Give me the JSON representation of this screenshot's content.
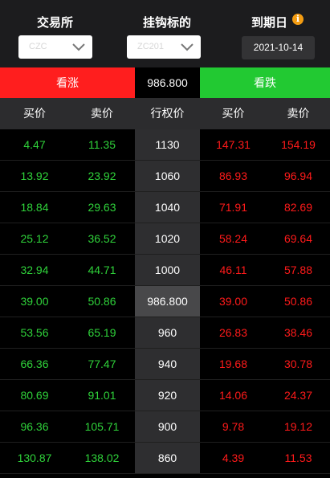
{
  "top": {
    "exchange_label": "交易所",
    "underlying_label": "挂钩标的",
    "expiry_label": "到期日",
    "info_icon": "info-icon",
    "exchange_value": "CZC",
    "underlying_value": "ZC201",
    "expiry_value": "2021-10-14"
  },
  "actions": {
    "up_label": "看涨",
    "underlying_price": "986.800",
    "down_label": "看跌"
  },
  "colors": {
    "up": "#ff1e1e",
    "down": "#22c932",
    "green_text": "#2fd23a",
    "red_text": "#ff1a1a"
  },
  "table": {
    "headers": [
      "买价",
      "卖价",
      "行权价",
      "买价",
      "卖价"
    ],
    "rows": [
      {
        "call_bid": "4.47",
        "call_ask": "11.35",
        "strike": "1130",
        "put_bid": "147.31",
        "put_ask": "154.19"
      },
      {
        "call_bid": "13.92",
        "call_ask": "23.92",
        "strike": "1060",
        "put_bid": "86.93",
        "put_ask": "96.94"
      },
      {
        "call_bid": "18.84",
        "call_ask": "29.63",
        "strike": "1040",
        "put_bid": "71.91",
        "put_ask": "82.69"
      },
      {
        "call_bid": "25.12",
        "call_ask": "36.52",
        "strike": "1020",
        "put_bid": "58.24",
        "put_ask": "69.64"
      },
      {
        "call_bid": "32.94",
        "call_ask": "44.71",
        "strike": "1000",
        "put_bid": "46.11",
        "put_ask": "57.88"
      },
      {
        "call_bid": "39.00",
        "call_ask": "50.86",
        "strike": "986.800",
        "put_bid": "39.00",
        "put_ask": "50.86",
        "atm": true
      },
      {
        "call_bid": "53.56",
        "call_ask": "65.19",
        "strike": "960",
        "put_bid": "26.83",
        "put_ask": "38.46"
      },
      {
        "call_bid": "66.36",
        "call_ask": "77.47",
        "strike": "940",
        "put_bid": "19.68",
        "put_ask": "30.78"
      },
      {
        "call_bid": "80.69",
        "call_ask": "91.01",
        "strike": "920",
        "put_bid": "14.06",
        "put_ask": "24.37"
      },
      {
        "call_bid": "96.36",
        "call_ask": "105.71",
        "strike": "900",
        "put_bid": "9.78",
        "put_ask": "19.12"
      },
      {
        "call_bid": "130.87",
        "call_ask": "138.02",
        "strike": "860",
        "put_bid": "4.39",
        "put_ask": "11.53"
      }
    ]
  }
}
